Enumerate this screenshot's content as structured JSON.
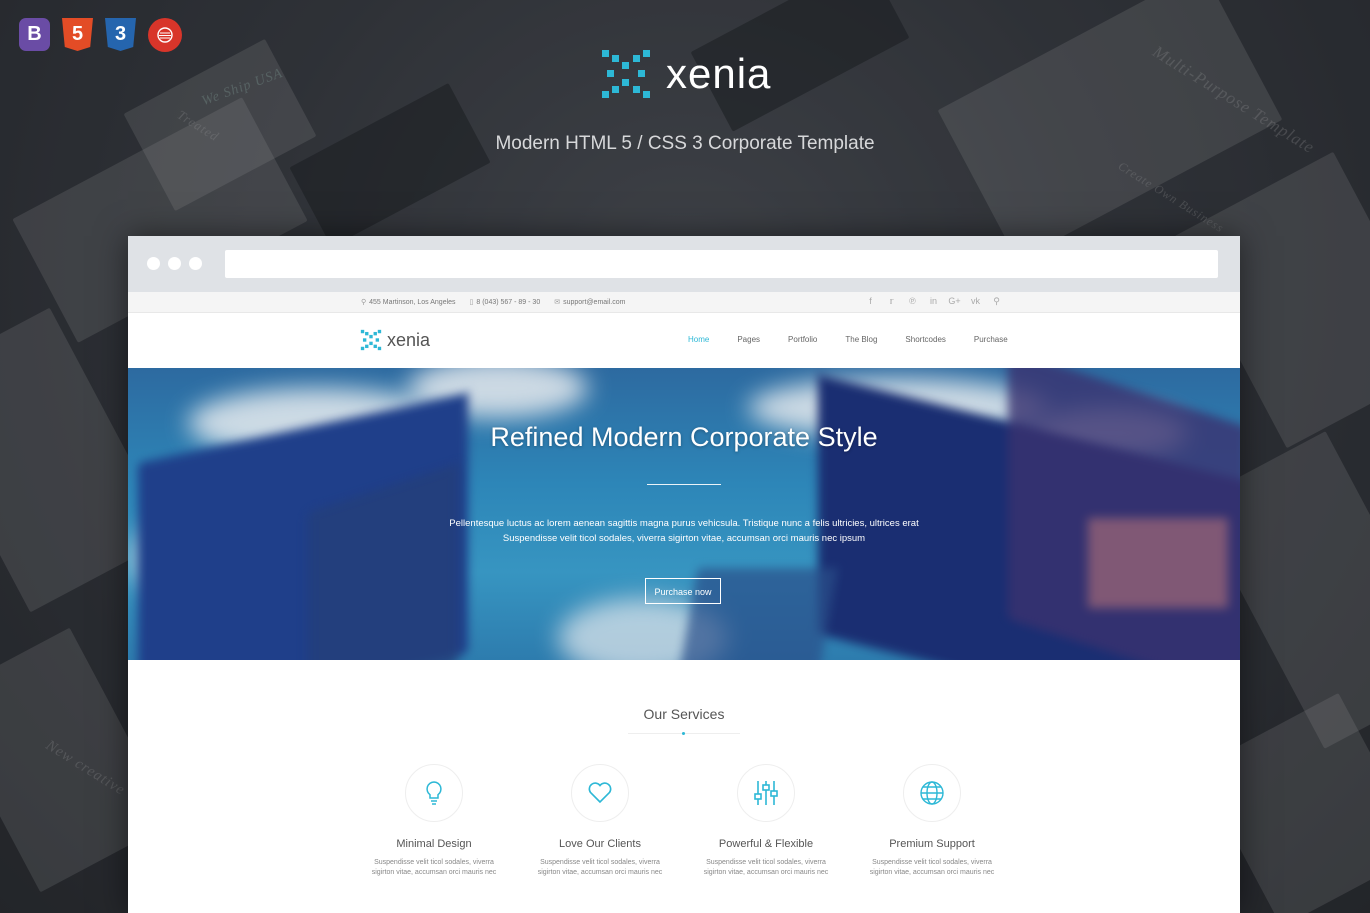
{
  "badges": {
    "bootstrap": "B",
    "html5": "5",
    "css3": "3"
  },
  "brand": {
    "name": "xenia",
    "tagline": "Modern HTML 5 / CSS 3 Corporate Template",
    "accent_color": "#2db8d6"
  },
  "background_text": {
    "a": "Multi-Purpose Template",
    "b": "Create Own Business",
    "c": "New creative",
    "d": "We Ship USA",
    "e": "Treated"
  },
  "site": {
    "topbar": {
      "address": "455 Martinson, Los Angeles",
      "phone": "8 (043) 567 - 89 - 30",
      "email": "support@email.com",
      "social_icons": [
        "facebook-icon",
        "twitter-icon",
        "pinterest-icon",
        "linkedin-icon",
        "google-plus-icon",
        "vk-icon",
        "search-icon"
      ]
    },
    "nav": {
      "logo": "xenia",
      "items": [
        "Home",
        "Pages",
        "Portfolio",
        "The Blog",
        "Shortcodes",
        "Purchase"
      ],
      "active": "Home"
    },
    "hero": {
      "title": "Refined Modern Corporate Style",
      "line1": "Pellentesque luctus ac lorem aenean sagittis magna purus vehicsula. Tristique nunc a felis ultricies, ultrices erat",
      "line2": "Suspendisse velit ticol sodales, viverra sigirton vitae, accumsan orci mauris nec ipsum",
      "button": "Purchase now"
    },
    "services": {
      "title": "Our Services",
      "items": [
        {
          "icon": "lightbulb-icon",
          "title": "Minimal Design",
          "desc1": "Suspendisse velit ticol sodales, viverra",
          "desc2": "sigirton vitae, accumsan orci mauris nec"
        },
        {
          "icon": "heart-icon",
          "title": "Love Our Clients",
          "desc1": "Suspendisse velit ticol sodales, viverra",
          "desc2": "sigirton vitae, accumsan orci mauris nec"
        },
        {
          "icon": "sliders-icon",
          "title": "Powerful & Flexible",
          "desc1": "Suspendisse velit ticol sodales, viverra",
          "desc2": "sigirton vitae, accumsan orci mauris nec"
        },
        {
          "icon": "globe-icon",
          "title": "Premium Support",
          "desc1": "Suspendisse velit ticol sodales, viverra",
          "desc2": "sigirton vitae, accumsan orci mauris nec"
        }
      ]
    }
  }
}
